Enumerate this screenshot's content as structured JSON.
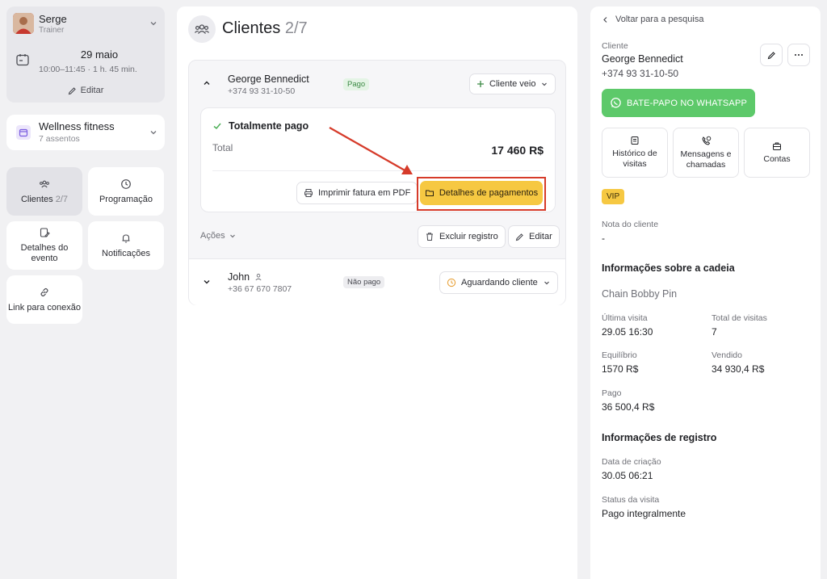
{
  "sidebar": {
    "user": {
      "name": "Serge",
      "role": "Trainer"
    },
    "schedule": {
      "date": "29 maio",
      "time": "10:00–11:45 · 1 h. 45 min.",
      "edit_label": "Editar"
    },
    "venue": {
      "name": "Wellness fitness",
      "seats": "7 assentos"
    },
    "tiles": [
      {
        "label": "Clientes",
        "count": "2/7",
        "icon": "users-icon"
      },
      {
        "label": "Programação",
        "icon": "clock-icon"
      },
      {
        "label": "Detalhes do evento",
        "icon": "edit-doc-icon"
      },
      {
        "label": "Notificações",
        "icon": "bell-icon"
      },
      {
        "label": "Link para conexão",
        "icon": "link-icon"
      }
    ]
  },
  "main": {
    "title": "Clientes",
    "count": "2/7",
    "clients": [
      {
        "name": "George Bennedict",
        "phone": "+374 93 31-10-50",
        "badge": "Pago",
        "status": "Cliente veio",
        "payment": {
          "title": "Totalmente pago",
          "total_label": "Total",
          "total_value": "17 460 R$",
          "print_label": "Imprimir fatura em PDF",
          "details_label": "Detalhes de pagamentos"
        },
        "actions_label": "Ações",
        "delete_label": "Excluir registro",
        "edit_label": "Editar"
      },
      {
        "name": "John",
        "phone": "+36 67 670 7807",
        "badge": "Não pago",
        "status": "Aguardando cliente"
      }
    ]
  },
  "details": {
    "back_label": "Voltar para a pesquisa",
    "client_label": "Cliente",
    "client_name": "George Bennedict",
    "client_phone": "+374 93 31-10-50",
    "whatsapp_label": "BATE-PAPO NO WHATSAPP",
    "tiles": [
      {
        "label": "Histórico de visitas",
        "icon": "history-icon"
      },
      {
        "label": "Mensagens e chamadas",
        "icon": "phone-chat-icon"
      },
      {
        "label": "Contas",
        "icon": "briefcase-icon"
      }
    ],
    "tag": "VIP",
    "note_label": "Nota do cliente",
    "note_value": "-",
    "chain_heading": "Informações sobre a cadeia",
    "chain_name": "Chain Bobby Pin",
    "last_visit_label": "Última visita",
    "last_visit_value": "29.05 16:30",
    "total_visits_label": "Total de visitas",
    "total_visits_value": "7",
    "balance_label": "Equilíbrio",
    "balance_value": "1570 R$",
    "sold_label": "Vendido",
    "sold_value": "34 930,4 R$",
    "paid_label": "Pago",
    "paid_value": "36 500,4 R$",
    "registration_heading": "Informações de registro",
    "created_label": "Data de criação",
    "created_value": "30.05 06:21",
    "visit_status_label": "Status da visita",
    "visit_status_value": "Pago integralmente"
  },
  "colors": {
    "accent_yellow": "#f6c842",
    "whatsapp_green": "#5dc96a",
    "annotation_red": "#d63b2a",
    "paid_green": "#3c8a45"
  }
}
